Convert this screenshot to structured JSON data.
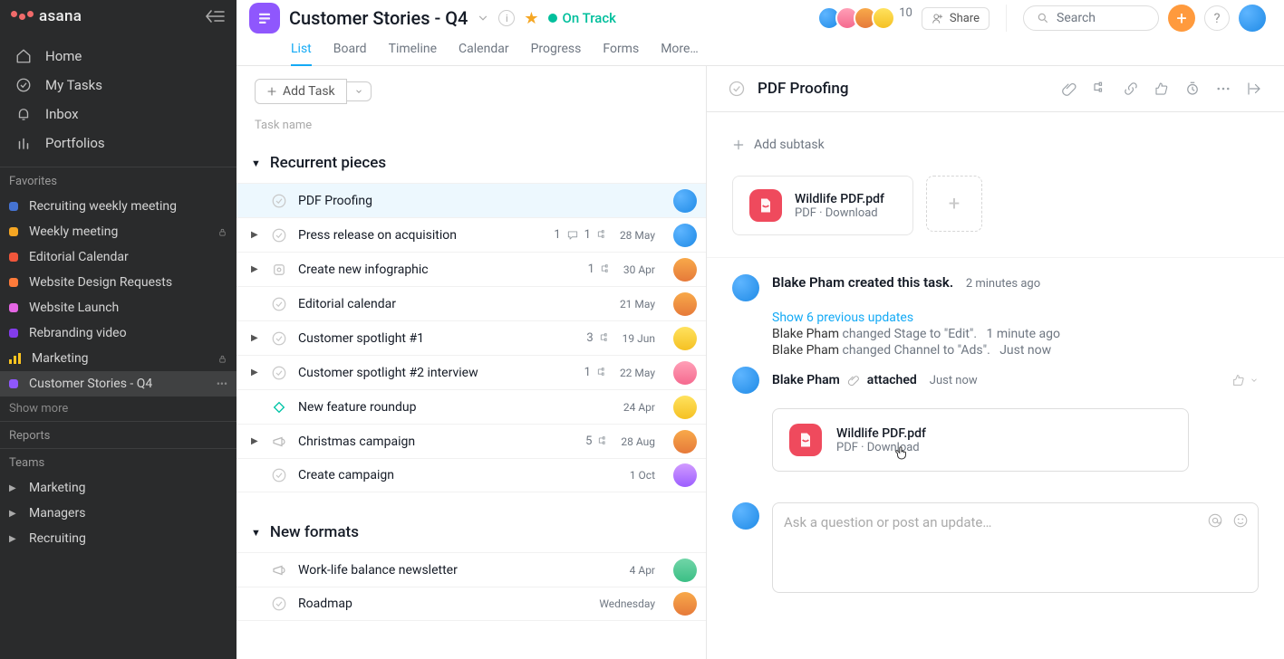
{
  "brand": {
    "name": "asana"
  },
  "nav": {
    "home": "Home",
    "my_tasks": "My Tasks",
    "inbox": "Inbox",
    "portfolios": "Portfolios"
  },
  "favorites": {
    "heading": "Favorites",
    "show_more": "Show more",
    "items": [
      {
        "label": "Recruiting weekly meeting",
        "color": "#4573d2",
        "locked": false
      },
      {
        "label": "Weekly meeting",
        "color": "#f5a623",
        "locked": true
      },
      {
        "label": "Editorial Calendar",
        "color": "#f0563b",
        "locked": false
      },
      {
        "label": "Website Design Requests",
        "color": "#ff7b3a",
        "locked": false
      },
      {
        "label": "Website Launch",
        "color": "#e466e4",
        "locked": false
      },
      {
        "label": "Rebranding video",
        "color": "#833ceb",
        "locked": false
      },
      {
        "label": "Marketing",
        "type": "bars",
        "locked": true
      },
      {
        "label": "Customer Stories - Q4",
        "color": "#8f57fd",
        "locked": false,
        "selected": true
      }
    ]
  },
  "reports": {
    "heading": "Reports"
  },
  "teams": {
    "heading": "Teams",
    "items": [
      {
        "label": "Marketing"
      },
      {
        "label": "Managers"
      },
      {
        "label": "Recruiting"
      }
    ]
  },
  "project": {
    "title": "Customer Stories - Q4",
    "status": "On Track",
    "member_count": "10",
    "share_label": "Share"
  },
  "tabs": {
    "items": [
      {
        "label": "List",
        "active": true
      },
      {
        "label": "Board"
      },
      {
        "label": "Timeline"
      },
      {
        "label": "Calendar"
      },
      {
        "label": "Progress"
      },
      {
        "label": "Forms"
      },
      {
        "label": "More…"
      }
    ]
  },
  "toolbar": {
    "add_task": "Add Task"
  },
  "columns": {
    "task_name": "Task name"
  },
  "search": {
    "placeholder": "Search"
  },
  "plus_label": "+",
  "sections": {
    "s1": {
      "title": "Recurrent pieces",
      "tasks": [
        {
          "name": "PDF Proofing",
          "date": "",
          "selected": true,
          "av": "grad-bp"
        },
        {
          "name": "Press release on acquisition",
          "date": "28 May",
          "meta_comments": "1",
          "meta_sub": "1",
          "hasSub": true,
          "av": "grad-bp"
        },
        {
          "name": "Create new infographic",
          "date": "30 Apr",
          "meta_sub": "1",
          "hasSub": true,
          "av": "grad-r",
          "milestone": true
        },
        {
          "name": "Editorial calendar",
          "date": "21 May",
          "av": "grad-r"
        },
        {
          "name": "Customer spotlight #1",
          "date": "19 Jun",
          "meta_sub": "3",
          "hasSub": true,
          "av": "grad-y"
        },
        {
          "name": "Customer spotlight #2 interview",
          "date": "22 May",
          "meta_sub": "1",
          "hasSub": true,
          "av": "grad-pk"
        },
        {
          "name": "New feature roundup",
          "date": "24 Apr",
          "av": "grad-y",
          "diamond": true
        },
        {
          "name": "Christmas campaign",
          "date": "28 Aug",
          "meta_sub": "5",
          "hasSub": true,
          "av": "grad-r",
          "campaign": true
        },
        {
          "name": "Create campaign",
          "date": "1 Oct",
          "av": "grad-p"
        }
      ]
    },
    "s2": {
      "title": "New formats",
      "tasks": [
        {
          "name": "Work-life balance newsletter",
          "date": "4 Apr",
          "av": "grad-g",
          "campaign": true
        },
        {
          "name": "Roadmap",
          "date": "Wednesday",
          "av": "grad-r"
        }
      ]
    }
  },
  "detail": {
    "title": "PDF Proofing",
    "add_subtask": "Add subtask",
    "attachment": {
      "name": "Wildlife PDF.pdf",
      "sub": "PDF · Download"
    },
    "feed": {
      "creator": "Blake Pham",
      "created_text": "created this task.",
      "created_ts": "2 minutes ago",
      "show_prev": "Show 6 previous updates",
      "log1_user": "Blake Pham",
      "log1_action": "changed Stage to \"Edit\".",
      "log1_ts": "1 minute ago",
      "log2_user": "Blake Pham",
      "log2_action": "changed Channel to \"Ads\".",
      "log2_ts": "Just now",
      "attach_user": "Blake Pham",
      "attach_word": "attached",
      "attach_ts": "Just now",
      "attach_name": "Wildlife PDF.pdf",
      "attach_sub": "PDF · Download"
    },
    "composer_placeholder": "Ask a question or post an update…"
  }
}
